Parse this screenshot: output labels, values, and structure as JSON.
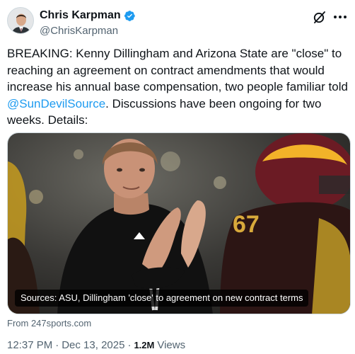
{
  "author": {
    "display_name": "Chris Karpman",
    "handle": "@ChrisKarpman",
    "verified": true,
    "verified_color": "#1d9bf0"
  },
  "icons": [
    "verified-badge-icon",
    "grok-icon",
    "more-icon"
  ],
  "tweet": {
    "text_before": "BREAKING: Kenny Dillingham and Arizona State are \"close\" to reaching an agreement on contract amendments that would increase his annual base compensation, two people familiar told ",
    "mention": "@SunDevilSource",
    "text_after": ". Discussions have been ongoing for two weeks. Details:",
    "link_color": "#1d9bf0"
  },
  "card": {
    "caption": "Sources: ASU, Dillingham 'close' to agreement on new contract terms",
    "source": "From 247sports.com",
    "jersey_number": "67"
  },
  "meta": {
    "time": "12:37 PM",
    "separator": "·",
    "date": "Dec 13, 2025",
    "views_count": "1.2M",
    "views_label": "Views"
  }
}
